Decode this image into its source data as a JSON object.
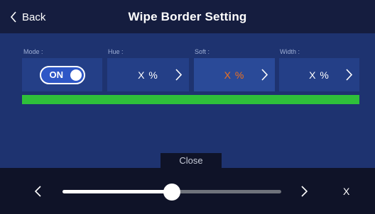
{
  "header": {
    "back_label": "Back",
    "title": "Wipe Border Setting"
  },
  "params": {
    "mode": {
      "label": "Mode :",
      "value": "ON"
    },
    "hue": {
      "label": "Hue :",
      "value": "X %"
    },
    "soft": {
      "label": "Soft :",
      "value": "X %",
      "color": "#f2711c"
    },
    "width": {
      "label": "Width :",
      "value": "X %"
    }
  },
  "close_label": "Close",
  "slider": {
    "value_fraction": 0.5,
    "close_label": "X"
  },
  "colors": {
    "accent_green": "#2fc03a",
    "toggle_blue": "#2e57c6",
    "panel_blue": "#1e3370"
  },
  "icons": [
    "chevron-left-icon",
    "chevron-right-icon",
    "close-icon"
  ]
}
